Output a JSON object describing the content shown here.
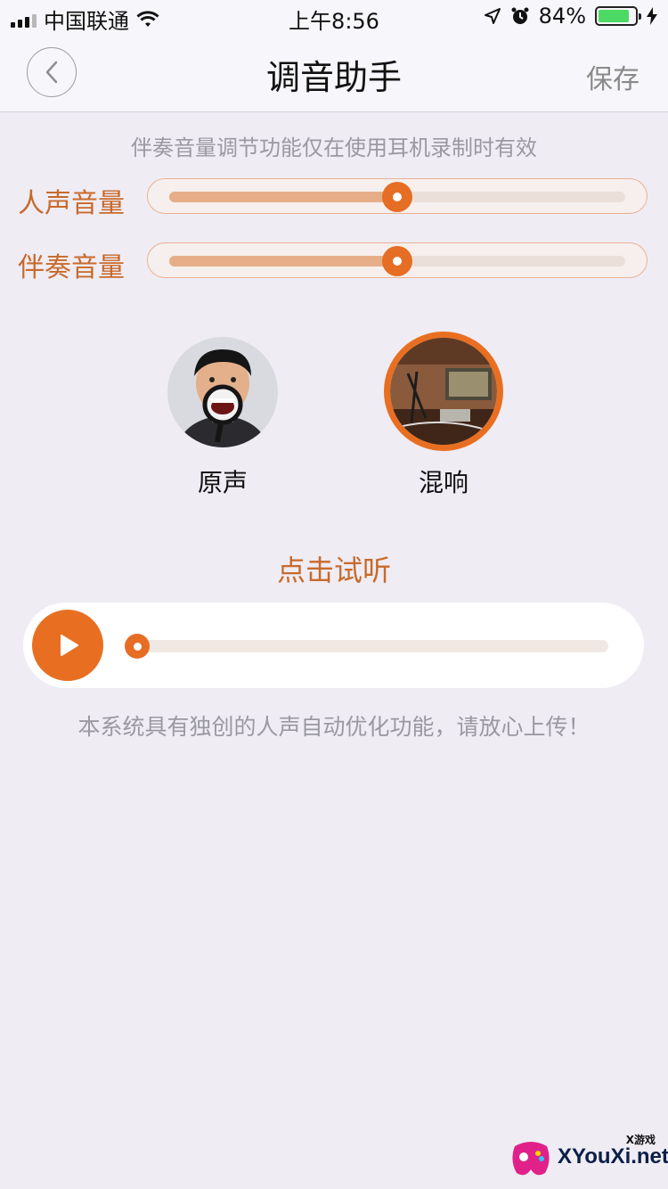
{
  "status_bar": {
    "carrier": "中国联通",
    "time": "上午8:56",
    "battery_percent": "84%",
    "battery_level": 0.84
  },
  "nav": {
    "title": "调音助手",
    "save_label": "保存"
  },
  "hint": "伴奏音量调节功能仅在使用耳机录制时有效",
  "sliders": [
    {
      "label": "人声音量",
      "value": 0.5
    },
    {
      "label": "伴奏音量",
      "value": 0.5
    }
  ],
  "effects": [
    {
      "label": "原声",
      "selected": false
    },
    {
      "label": "混响",
      "selected": true
    }
  ],
  "listen": {
    "title": "点击试听",
    "progress": 0.0
  },
  "footer_note": "本系统具有独创的人声自动优化功能，请放心上传！",
  "watermark": {
    "text": "XYouXi.net",
    "sub": "X游戏"
  },
  "colors": {
    "accent": "#e86f22",
    "label_orange": "#c86a2a",
    "background": "#efecf4"
  }
}
